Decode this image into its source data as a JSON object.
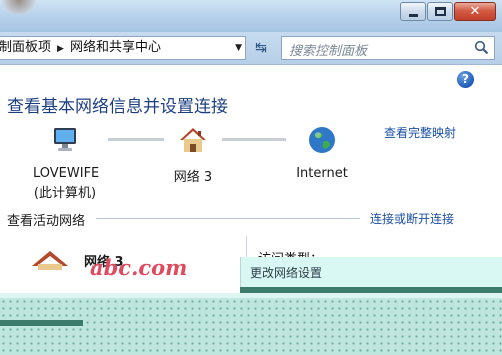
{
  "window": {
    "close_glyph": "✕"
  },
  "address": {
    "breadcrumbs": [
      "制面板项",
      "网络和共享中心"
    ],
    "separator_glyph": "▶",
    "dropdown_glyph": "▼",
    "refresh_glyph": "↹"
  },
  "search": {
    "placeholder": "搜索控制面板"
  },
  "content": {
    "help_glyph": "?",
    "title": "查看基本网络信息并设置连接",
    "full_map_link": "查看完整映射",
    "nodes": {
      "computer": {
        "name": "LOVEWIFE",
        "sub": "(此计算机)",
        "icon": "computer-icon"
      },
      "network": {
        "name": "网络  3",
        "icon": "house-icon"
      },
      "internet": {
        "name": "Internet",
        "icon": "globe-icon"
      }
    },
    "active_networks_label": "查看活动网络",
    "connect_link": "连接或断开连接",
    "active_network_name": "网络  3",
    "access_type_label": "访问类型：",
    "change_settings_label": "更改网络设置"
  },
  "watermark": {
    "text": "abc.com"
  },
  "colors": {
    "accent_blue": "#1d3f82",
    "link_blue": "#1a4fa3",
    "title_bar": "#b5d0ea",
    "band_teal": "#3d7b6c",
    "watermark_red": "#e04a5f"
  }
}
